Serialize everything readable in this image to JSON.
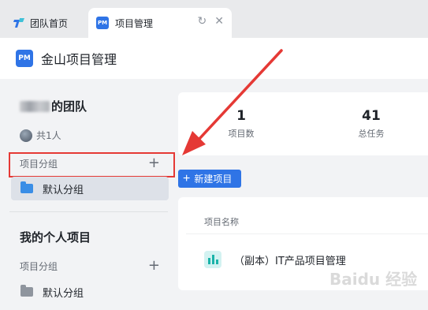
{
  "tabs": [
    {
      "label": "团队首页",
      "icon": "team-home-icon"
    },
    {
      "label": "项目管理",
      "icon": "pm-icon",
      "badge": "PM"
    }
  ],
  "tab_actions": {
    "refresh": "↻",
    "close": "✕"
  },
  "app": {
    "logo": "PM",
    "title": "金山项目管理"
  },
  "sidebar": {
    "team_suffix": "的团队",
    "members": "共1人",
    "team_group_label": "项目分组",
    "team_default_group": "默认分组",
    "personal_title": "我的个人项目",
    "personal_group_label": "项目分组",
    "personal_default_group": "默认分组",
    "add": "+"
  },
  "stats": [
    {
      "value": "1",
      "label": "项目数"
    },
    {
      "value": "41",
      "label": "总任务"
    }
  ],
  "new_project_button": "新建项目",
  "list": {
    "header": "项目名称",
    "rows": [
      {
        "name": "（副本）IT产品项目管理"
      }
    ]
  },
  "colors": {
    "accent": "#2f74e6",
    "highlight": "#e53935",
    "arrow": "#e53935"
  },
  "watermark": "Baidu 经验"
}
